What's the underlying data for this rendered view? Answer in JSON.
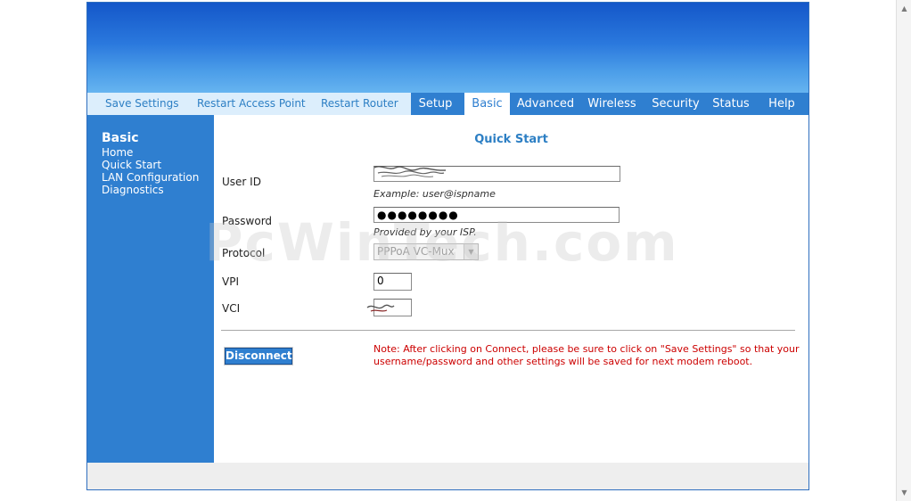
{
  "top_links": [
    "Save Settings",
    "Restart Access Point",
    "Restart Router"
  ],
  "tabs": [
    "Setup",
    "Basic",
    "Advanced",
    "Wireless",
    "Security",
    "Status",
    "Help"
  ],
  "active_tab": "Basic",
  "sidebar": {
    "heading": "Basic",
    "items": [
      "Home",
      "Quick Start",
      "LAN Configuration",
      "Diagnostics"
    ]
  },
  "main": {
    "title": "Quick Start",
    "user_id": {
      "label": "User ID",
      "hint": "Example: user@ispname"
    },
    "password": {
      "label": "Password",
      "value": "●●●●●●●●",
      "hint": "Provided by your ISP."
    },
    "protocol": {
      "label": "Protocol",
      "selected": "PPPoA VC-Mux"
    },
    "vpi": {
      "label": "VPI",
      "value": "0"
    },
    "vci": {
      "label": "VCI"
    },
    "disconnect_label": "Disconnect",
    "note": "Note: After clicking on Connect, please be sure to click on \"Save Settings\" so that your username/password and other settings will be saved for next modem reboot."
  },
  "watermark": "PcWinTech.com",
  "colors": {
    "accent": "#2f7fd0",
    "note": "#cc0000",
    "link": "#2d7fc4"
  }
}
